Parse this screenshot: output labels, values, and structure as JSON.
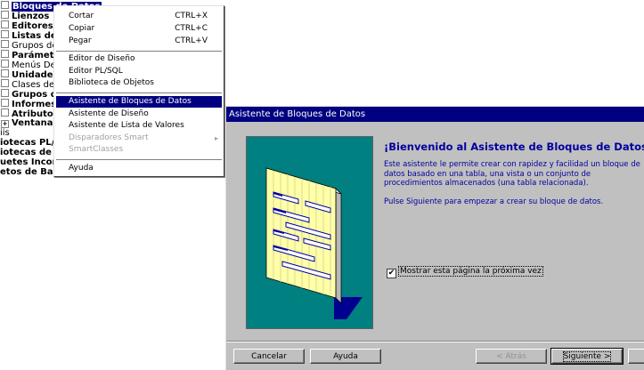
{
  "tree": {
    "items": [
      {
        "label": "Bloques de Datos",
        "selected": true,
        "bold": true
      },
      {
        "label": "Lienzos",
        "bold": true
      },
      {
        "label": "Editores",
        "bold": true
      },
      {
        "label": "Listas de V",
        "bold": true
      },
      {
        "label": "Grupos de",
        "bold": false
      },
      {
        "label": "Parámetro",
        "bold": true
      },
      {
        "label": "Menús Des",
        "bold": false
      },
      {
        "label": "Unidades c",
        "bold": true
      },
      {
        "label": "Clases de I",
        "bold": false
      },
      {
        "label": "Grupos de",
        "bold": true
      },
      {
        "label": "Informes",
        "bold": true
      },
      {
        "label": "Atributos V",
        "bold": true
      },
      {
        "label": "Ventanas",
        "bold": true
      },
      {
        "label": "iis",
        "bold": false
      },
      {
        "label": "iotecas PL/SQ",
        "bold": true
      },
      {
        "label": "iotecas de Ob",
        "bold": true
      },
      {
        "label": "uetes Incorpo",
        "bold": true
      },
      {
        "label": "etos de Base de Datos",
        "bold": true
      }
    ]
  },
  "context_menu": {
    "groups": [
      [
        {
          "label": "Cortar",
          "shortcut": "CTRL+X"
        },
        {
          "label": "Copiar",
          "shortcut": "CTRL+C"
        },
        {
          "label": "Pegar",
          "shortcut": "CTRL+V"
        }
      ],
      [
        {
          "label": "Editor de Diseño"
        },
        {
          "label": "Editor PL/SQL"
        },
        {
          "label": "Biblioteca de Objetos"
        }
      ],
      [
        {
          "label": "Asistente de Bloques de Datos",
          "highlighted": true
        },
        {
          "label": "Asistente de Diseño"
        },
        {
          "label": "Asistente de Lista de Valores"
        },
        {
          "label": "Disparadores Smart",
          "disabled": true,
          "submenu_arrow": "▸"
        },
        {
          "label": "SmartClasses",
          "disabled": true
        }
      ],
      [
        {
          "label": "Ayuda"
        }
      ]
    ]
  },
  "wizard": {
    "title": "Asistente de Bloques de Datos",
    "welcome_title": "¡Bienvenido al Asistente de Bloques de Datos!",
    "welcome_text": "Este asistente le permite crear con rapidez y facilidad un bloque de datos basado en una tabla, una vista o un conjunto de procedimientos almacenados (una tabla relacionada).",
    "next_hint": "Pulse Siguiente para empezar a crear su bloque de datos.",
    "checkbox_label": "Mostrar esta página la próxima vez",
    "checkbox_checked": true,
    "buttons": {
      "cancel": "Cancelar",
      "help": "Ayuda",
      "back": "< Atrás",
      "next": "Siguiente >"
    },
    "colors": {
      "panel": "#008080",
      "titlebar": "#000080",
      "welcome_text": "#0000a0"
    }
  }
}
